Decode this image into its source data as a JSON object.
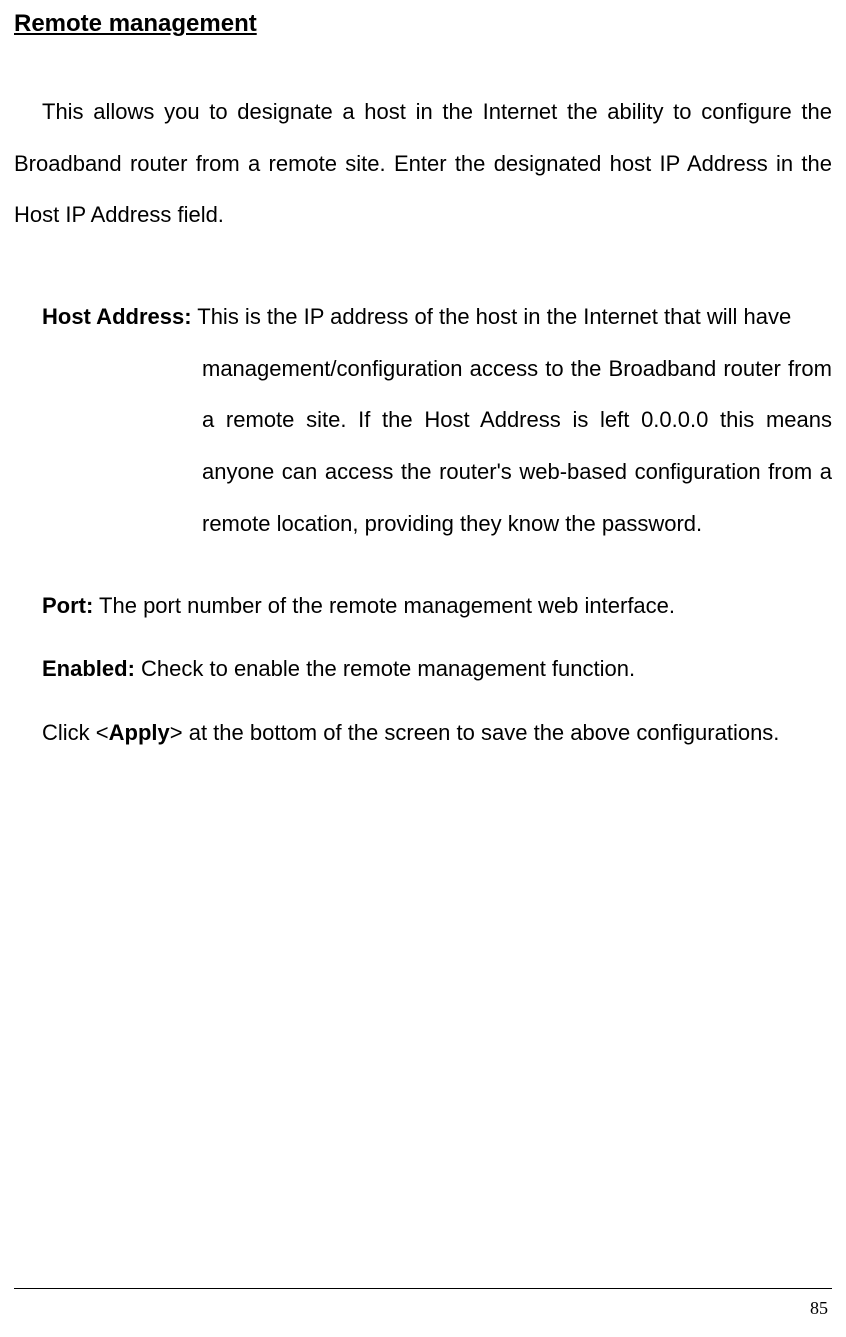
{
  "heading": "Remote management",
  "intro": "This allows you to designate a host in the Internet the ability to configure the Broadband router from a remote site. Enter the designated host IP Address in the Host IP Address field.",
  "hostAddress": {
    "label": "Host Address:",
    "firstLinePart": " This is the IP address of the host in the Internet that will have",
    "rest": "management/configuration access to the Broadband router from a remote site. If the Host Address is left 0.0.0.0 this means anyone can access the router's web-based configuration from a remote location, providing they know the password."
  },
  "port": {
    "label": "Port:",
    "text": " The port number of the remote management web interface."
  },
  "enabled": {
    "label": "Enabled:",
    "text": " Check to enable the remote management function."
  },
  "apply": {
    "pre": "Click <",
    "bold": "Apply",
    "post": "> at the bottom of the screen to save the above configurations."
  },
  "pageNumber": "85"
}
